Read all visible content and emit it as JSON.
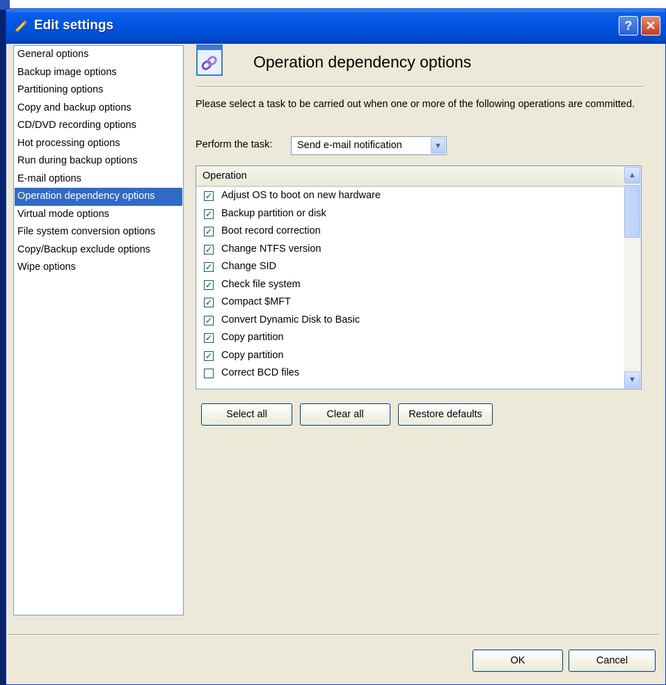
{
  "window": {
    "title": "Edit settings",
    "help_label": "?",
    "close_label": "✕"
  },
  "sidebar": {
    "items": [
      {
        "label": "General options",
        "selected": false
      },
      {
        "label": "Backup image options",
        "selected": false
      },
      {
        "label": "Partitioning options",
        "selected": false
      },
      {
        "label": "Copy and backup options",
        "selected": false
      },
      {
        "label": "CD/DVD recording options",
        "selected": false
      },
      {
        "label": "Hot processing options",
        "selected": false
      },
      {
        "label": "Run during backup options",
        "selected": false
      },
      {
        "label": "E-mail options",
        "selected": false
      },
      {
        "label": "Operation dependency options",
        "selected": true
      },
      {
        "label": "Virtual mode options",
        "selected": false
      },
      {
        "label": "File system conversion options",
        "selected": false
      },
      {
        "label": "Copy/Backup exclude options",
        "selected": false
      },
      {
        "label": "Wipe options",
        "selected": false
      }
    ]
  },
  "main": {
    "title": "Operation dependency options",
    "description": "Please select a task to be carried out when one or more of the following operations are committed.",
    "perform_label": "Perform the task:",
    "task_value": "Send e-mail notification",
    "list_header": "Operation",
    "operations": [
      {
        "label": "Adjust OS to boot on new hardware",
        "checked": true
      },
      {
        "label": "Backup partition or disk",
        "checked": true
      },
      {
        "label": "Boot record correction",
        "checked": true
      },
      {
        "label": "Change NTFS version",
        "checked": true
      },
      {
        "label": "Change SID",
        "checked": true
      },
      {
        "label": "Check file system",
        "checked": true
      },
      {
        "label": "Compact $MFT",
        "checked": true
      },
      {
        "label": "Convert Dynamic Disk to Basic",
        "checked": true
      },
      {
        "label": "Copy partition",
        "checked": true
      },
      {
        "label": "Copy partition",
        "checked": true
      },
      {
        "label": "Correct BCD files",
        "checked": false
      }
    ],
    "select_all_label": "Select all",
    "clear_all_label": "Clear all",
    "restore_label": "Restore defaults"
  },
  "footer": {
    "ok_label": "OK",
    "cancel_label": "Cancel"
  },
  "colors": {
    "titlebar": "#0054e3",
    "selection": "#316ac5",
    "face": "#ece9d8",
    "check": "#21a121"
  }
}
